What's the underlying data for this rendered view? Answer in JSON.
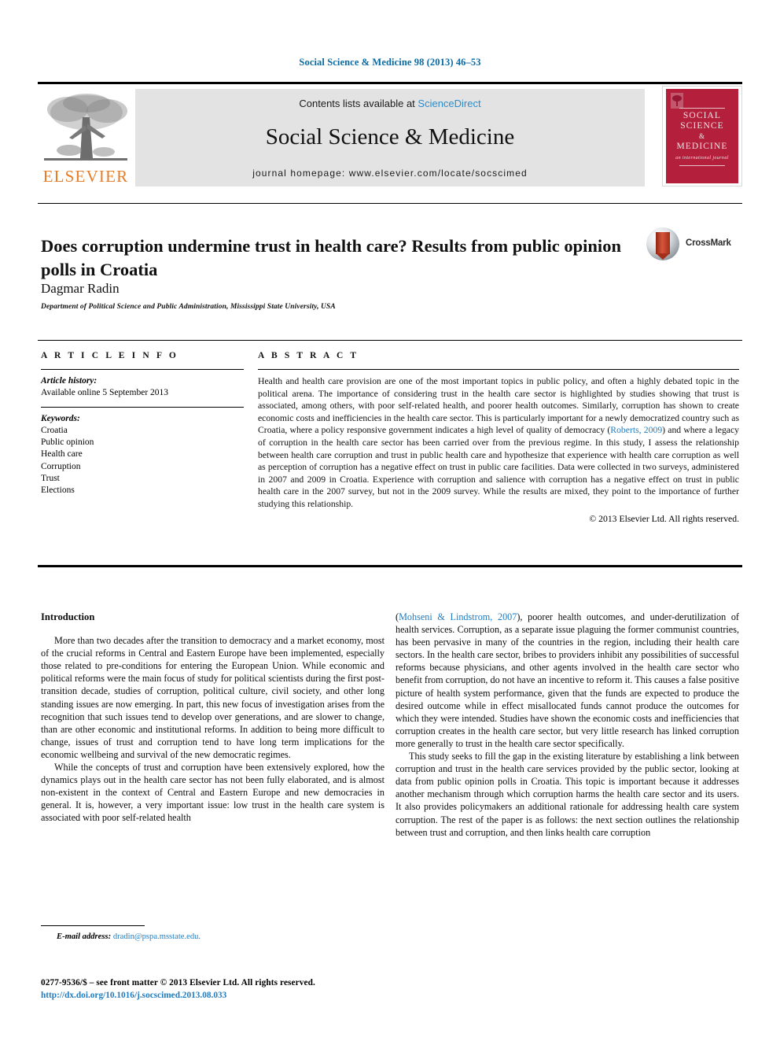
{
  "running_head": "Social Science & Medicine 98 (2013) 46–53",
  "masthead": {
    "publisher_name": "ELSEVIER",
    "contents_prefix": "Contents lists available at ",
    "contents_link": "ScienceDirect",
    "journal_title": "Social Science & Medicine",
    "homepage": "journal homepage: www.elsevier.com/locate/socscimed",
    "cover": {
      "line1": "SOCIAL",
      "line2": "SCIENCE",
      "amp": "&",
      "line3": "MEDICINE",
      "tagline": "an international journal"
    }
  },
  "article": {
    "title": "Does corruption undermine trust in health care? Results from public opinion polls in Croatia",
    "author": "Dagmar Radin",
    "affiliation": "Department of Political Science and Public Administration, Mississippi State University, USA",
    "crossmark_label": "CrossMark"
  },
  "article_info": {
    "heading": "A R T I C L E  I N F O",
    "history_label": "Article history:",
    "history_value": "Available online 5 September 2013",
    "keywords_label": "Keywords:",
    "keywords": [
      "Croatia",
      "Public opinion",
      "Health care",
      "Corruption",
      "Trust",
      "Elections"
    ]
  },
  "abstract": {
    "heading": "A B S T R A C T",
    "part1": "Health and health care provision are one of the most important topics in public policy, and often a highly debated topic in the political arena. The importance of considering trust in the health care sector is highlighted by studies showing that trust is associated, among others, with poor self-related health, and poorer health outcomes. Similarly, corruption has shown to create economic costs and inefficiencies in the health care sector. This is particularly important for a newly democratized country such as Croatia, where a policy responsive government indicates a high level of quality of democracy (",
    "ref1": "Roberts, 2009",
    "part2": ") and where a legacy of corruption in the health care sector has been carried over from the previous regime. In this study, I assess the relationship between health care corruption and trust in public health care and hypothesize that experience with health care corruption as well as perception of corruption has a negative effect on trust in public care facilities. Data were collected in two surveys, administered in 2007 and 2009 in Croatia. Experience with corruption and salience with corruption has a negative effect on trust in public health care in the 2007 survey, but not in the 2009 survey. While the results are mixed, they point to the importance of further studying this relationship.",
    "copyright": "© 2013 Elsevier Ltd. All rights reserved."
  },
  "body": {
    "intro_heading": "Introduction",
    "left_p1": "More than two decades after the transition to democracy and a market economy, most of the crucial reforms in Central and Eastern Europe have been implemented, especially those related to pre-conditions for entering the European Union. While economic and political reforms were the main focus of study for political scientists during the first post-transition decade, studies of corruption, political culture, civil society, and other long standing issues are now emerging. In part, this new focus of investigation arises from the recognition that such issues tend to develop over generations, and are slower to change, than are other economic and institutional reforms. In addition to being more difficult to change, issues of trust and corruption tend to have long term implications for the economic wellbeing and survival of the new democratic regimes.",
    "left_p2": "While the concepts of trust and corruption have been extensively explored, how the dynamics plays out in the health care sector has not been fully elaborated, and is almost non-existent in the context of Central and Eastern Europe and new democracies in general. It is, however, a very important issue: low trust in the health care system is associated with poor self-related health",
    "right_p1_open": "(",
    "right_p1_ref": "Mohseni & Lindstrom, 2007",
    "right_p1_rest": "), poorer health outcomes, and under-derutilization of health services. Corruption, as a separate issue plaguing the former communist countries, has been pervasive in many of the countries in the region, including their health care sectors. In the health care sector, bribes to providers inhibit any possibilities of successful reforms because physicians, and other agents involved in the health care sector who benefit from corruption, do not have an incentive to reform it. This causes a false positive picture of health system performance, given that the funds are expected to produce the desired outcome while in effect misallocated funds cannot produce the outcomes for which they were intended. Studies have shown the economic costs and inefficiencies that corruption creates in the health care sector, but very little research has linked corruption more generally to trust in the health care sector specifically.",
    "right_p2": "This study seeks to fill the gap in the existing literature by establishing a link between corruption and trust in the health care services provided by the public sector, looking at data from public opinion polls in Croatia. This topic is important because it addresses another mechanism through which corruption harms the health care sector and its users. It also provides policymakers an additional rationale for addressing health care system corruption. The rest of the paper is as follows: the next section outlines the relationship between trust and corruption, and then links health care corruption"
  },
  "footer": {
    "email_label": "E-mail address:",
    "email_value": "dradin@pspa.msstate.edu.",
    "issn_line": "0277-9536/$ – see front matter © 2013 Elsevier Ltd. All rights reserved.",
    "doi": "http://dx.doi.org/10.1016/j.socscimed.2013.08.033"
  },
  "colors": {
    "link": "#1f7cc0",
    "running_head": "#0a6ba3",
    "elsevier_orange": "#e77b26",
    "cover_red": "#b4203c",
    "band_grey": "#e3e3e3"
  }
}
